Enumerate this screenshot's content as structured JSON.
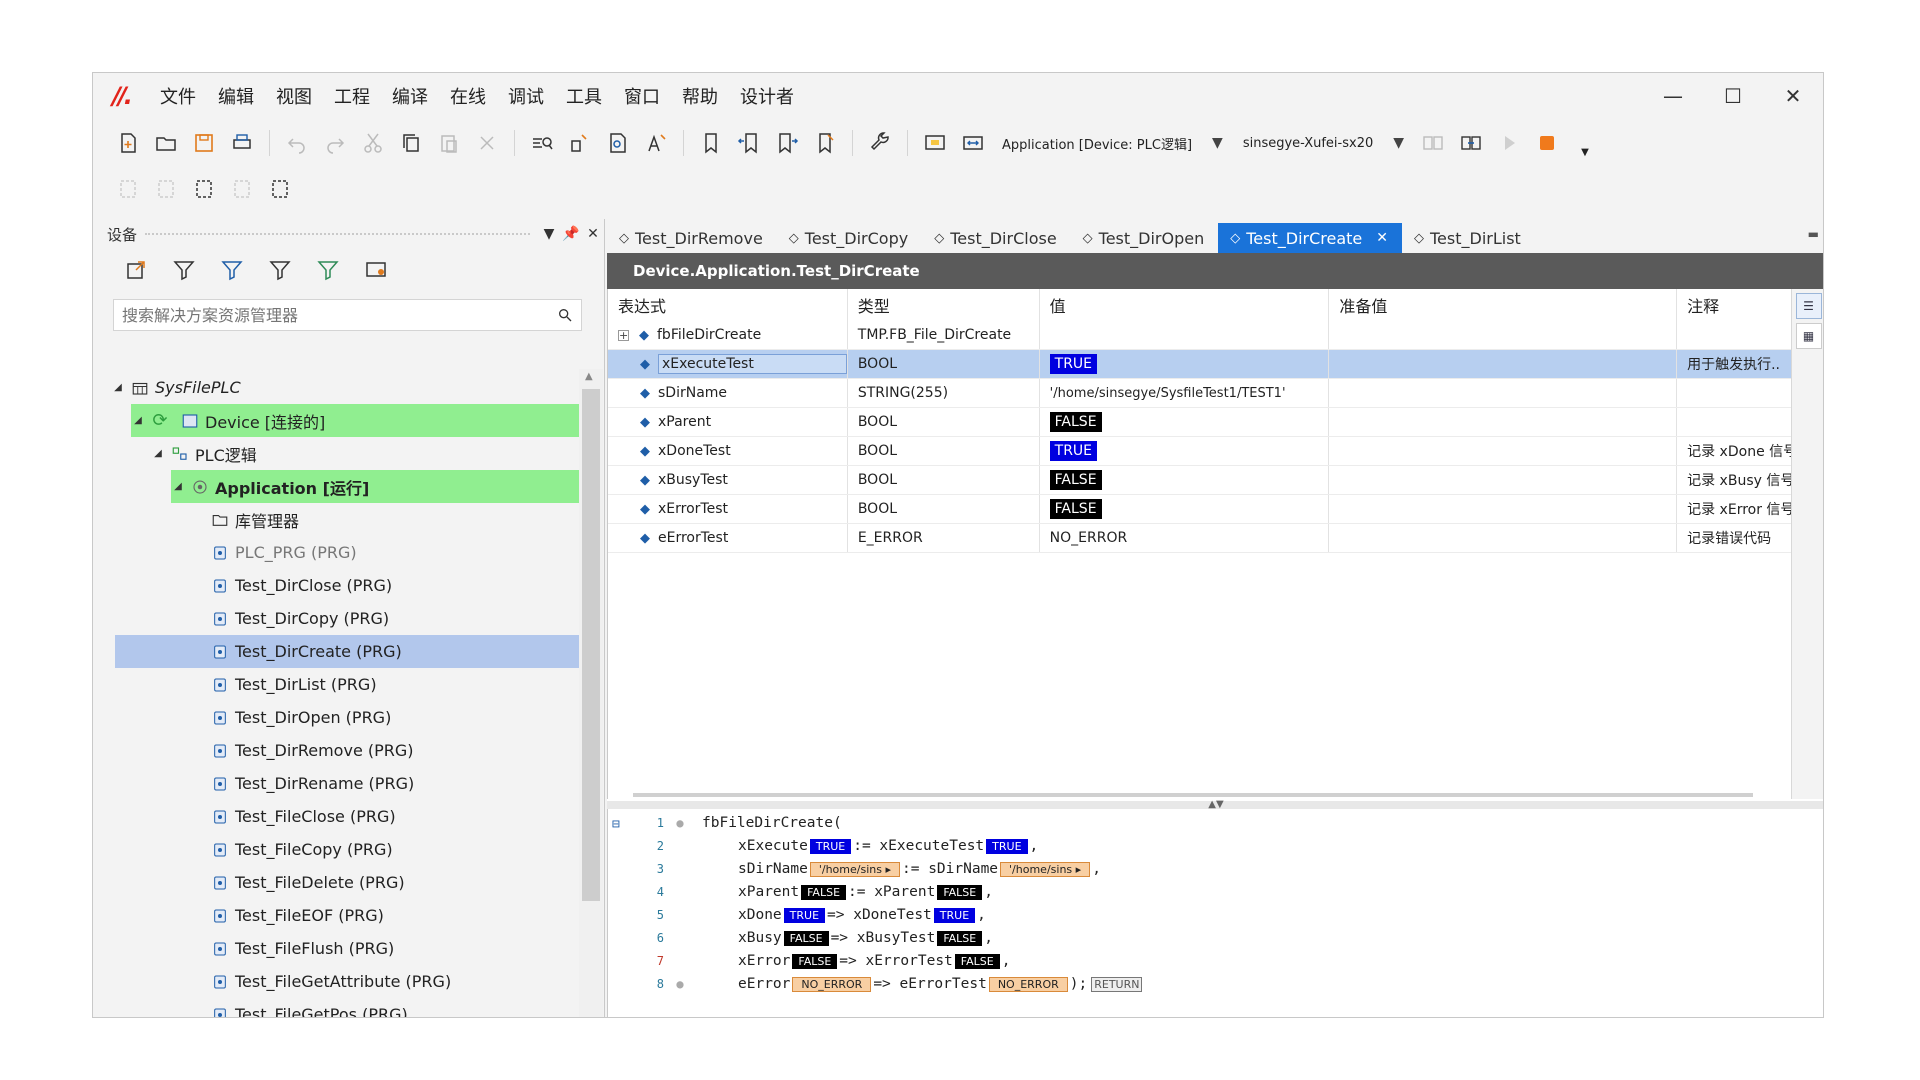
{
  "menu": [
    "文件",
    "编辑",
    "视图",
    "工程",
    "编译",
    "在线",
    "调试",
    "工具",
    "窗口",
    "帮助",
    "设计者"
  ],
  "toolbar": {
    "app_combo": "Application [Device: PLC逻辑]",
    "user_combo": "sinsegye-Xufei-sx20"
  },
  "devices_panel": {
    "title": "设备",
    "search_placeholder": "搜索解决方案资源管理器",
    "tree": [
      {
        "label": "SysFilePLC"
      },
      {
        "label": "Device [连接的]"
      },
      {
        "label": "PLC逻辑"
      },
      {
        "label": "Application [运行]"
      },
      {
        "label": "库管理器"
      },
      {
        "label": "PLC_PRG (PRG)"
      },
      {
        "label": "Test_DirClose (PRG)"
      },
      {
        "label": "Test_DirCopy (PRG)"
      },
      {
        "label": "Test_DirCreate (PRG)"
      },
      {
        "label": "Test_DirList (PRG)"
      },
      {
        "label": "Test_DirOpen (PRG)"
      },
      {
        "label": "Test_DirRemove (PRG)"
      },
      {
        "label": "Test_DirRename (PRG)"
      },
      {
        "label": "Test_FileClose (PRG)"
      },
      {
        "label": "Test_FileCopy (PRG)"
      },
      {
        "label": "Test_FileDelete (PRG)"
      },
      {
        "label": "Test_FileEOF (PRG)"
      },
      {
        "label": "Test_FileFlush (PRG)"
      },
      {
        "label": "Test_FileGetAttribute (PRG)"
      },
      {
        "label": "Test_FileGetPos (PRG)"
      }
    ]
  },
  "tabs": [
    "Test_DirRemove",
    "Test_DirCopy",
    "Test_DirClose",
    "Test_DirOpen",
    "Test_DirCreate",
    "Test_DirList"
  ],
  "editor_title": "Device.Application.Test_DirCreate",
  "watch": {
    "headers": [
      "表达式",
      "类型",
      "值",
      "准备值",
      "注释"
    ],
    "rows": [
      {
        "expr": "fbFileDirCreate",
        "type": "TMP.FB_File_DirCreate",
        "value": "",
        "prepared": "",
        "comment": ""
      },
      {
        "expr": "xExecuteTest",
        "type": "BOOL",
        "value": "TRUE",
        "prepared": "",
        "comment": "用于触发执行.."
      },
      {
        "expr": "sDirName",
        "type": "STRING(255)",
        "value": "'/home/sinsegye/SysfileTest1/TEST1'",
        "prepared": "",
        "comment": ""
      },
      {
        "expr": "xParent",
        "type": "BOOL",
        "value": "FALSE",
        "prepared": "",
        "comment": ""
      },
      {
        "expr": "xDoneTest",
        "type": "BOOL",
        "value": "TRUE",
        "prepared": "",
        "comment": "记录 xDone 信号"
      },
      {
        "expr": "xBusyTest",
        "type": "BOOL",
        "value": "FALSE",
        "prepared": "",
        "comment": "记录 xBusy 信号"
      },
      {
        "expr": "xErrorTest",
        "type": "BOOL",
        "value": "FALSE",
        "prepared": "",
        "comment": "记录 xError 信号"
      },
      {
        "expr": "eErrorTest",
        "type": "E_ERROR",
        "value": "NO_ERROR",
        "prepared": "",
        "comment": "记录错误代码"
      }
    ]
  },
  "code": {
    "line_numbers": [
      "1",
      "2",
      "3",
      "4",
      "5",
      "6",
      "7",
      "8"
    ],
    "l1": "fbFileDirCreate(",
    "l2a": "xExecute",
    "l2b": ":= xExecuteTest",
    "l2c": ",",
    "l3a": "sDirName",
    "l3b": ":= sDirName",
    "l3c": ",",
    "l4a": "xParent",
    "l4b": ":= xParent",
    "l4c": ",",
    "l5a": "xDone",
    "l5b": "=> xDoneTest",
    "l5c": ",",
    "l6a": "xBusy",
    "l6b": "=> xBusyTest",
    "l6c": ",",
    "l7a": "xError",
    "l7b": "=> xErrorTest",
    "l7c": ",",
    "l8a": "eError",
    "l8b": "=> eErrorTest",
    "l8c": ");",
    "v_true": "TRUE",
    "v_false": "FALSE",
    "v_str": "'/home/sins",
    "v_err": "NO_ERROR",
    "v_ret": "RETURN"
  }
}
